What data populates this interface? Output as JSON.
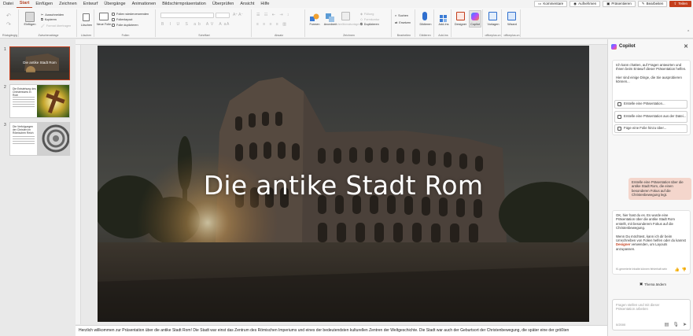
{
  "menu": {
    "tabs": [
      "Datei",
      "Start",
      "Einfügen",
      "Zeichnen",
      "Entwurf",
      "Übergänge",
      "Animationen",
      "Bildschirmpräsentation",
      "Überprüfen",
      "Ansicht",
      "Hilfe"
    ],
    "active_tab": "Start",
    "buttons": {
      "comments": "Kommentare",
      "record": "Aufnehmen",
      "present": "Präsentieren",
      "edit": "Bearbeiten",
      "share": "Teilen"
    }
  },
  "ribbon": {
    "undo_group": "Rückgängig",
    "clipboard": {
      "paste": "Einfügen",
      "cut": "Ausschneiden",
      "copy": "Kopieren",
      "format_painter": "Format übertragen",
      "group": "Zwischenablage"
    },
    "delete": {
      "label": "Löschen",
      "group": "Löschen"
    },
    "slides": {
      "new_slide": "Neue Folie",
      "reuse": "Folien wiederverwenden",
      "layout": "Folienlayout",
      "duplicate": "Folie duplizieren",
      "group": "Folien"
    },
    "font_group": "Schriftart",
    "paragraph_group": "Absatz",
    "drawing": {
      "shapes": "Formen",
      "arrange": "Anordnen",
      "quick_styles": "Schnellformatvorlagen",
      "fill": "Füllung",
      "outline": "Formkontur",
      "duplicate": "Duplizieren",
      "group": "Zeichnen"
    },
    "editing": {
      "find": "Suchen",
      "replace": "Ersetzen",
      "group": "Bearbeiten"
    },
    "voice": {
      "dictate": "Diktieren",
      "group": "Diktieren"
    },
    "addins": {
      "label": "Add-Ins",
      "group": "Add-Ins"
    },
    "designer": {
      "label": "Designer"
    },
    "copilot": {
      "label": "Copilot"
    },
    "templates": {
      "label": "Vorlagen",
      "group": "officeplus.cn"
    },
    "wizard": {
      "label": "Wizard",
      "group": "officeplus.cn"
    }
  },
  "slides": [
    {
      "number": "1",
      "title": "Die antike Stadt Rom"
    },
    {
      "number": "2",
      "title": "Die Entstehung des Christentums in Rom"
    },
    {
      "number": "3",
      "title": "Die Verfolgungen der Christen im Römischen Reich"
    }
  ],
  "slide": {
    "title": "Die antike Stadt Rom"
  },
  "notes": "Herzlich willkommen zur Präsentation über die antike Stadt Rom! Die Stadt war einst das Zentrum des Römischen Imperiums und eines der bedeutendsten kulturellen Zentren der Weltgeschichte. Die Stadt war auch der Geburtsort der Christenbewegung, die später eine der größten",
  "copilot": {
    "title": "Copilot",
    "intro": "Ich kann chatten, auf Fragen antworten und Ihnen beim Entwurf dieser Präsentation helfen.",
    "prompt": "Hier sind einige Dinge, die Sie ausprobieren können...",
    "suggestions": [
      "Erstelle eine Präsentation...",
      "Erstelle eine Präsentation aus der Datei...",
      "Füge eine Folie hinzu über..."
    ],
    "user_message": "Erstelle eine Präsentation über die antike Stadt Rom, die einen besonderen Fokus auf die Christenbewegung legt.",
    "reply_1": "OK, hier hast du es. Es wurde eine Präsentation über die antike Stadt Rom erstellt, mit besonderem Fokus auf die Christenbewegung.",
    "reply_2_pre": "Wenn Du möchtest, kann ich dir beim Umschreiben von Folien helfen oder du kannst",
    "reply_2_bold": "Designer",
    "reply_2_post": "verwenden, um Layouts anzupassen.",
    "disclaimer": "KI-generierte Inhalte können fehlerhaft sein",
    "theme_button": "Thema ändern",
    "input_placeholder": "Fragen stellen und mit dieser Präsentation arbeiten",
    "char_count": "0/2000"
  },
  "colors": {
    "accent": "#c43e1c"
  }
}
